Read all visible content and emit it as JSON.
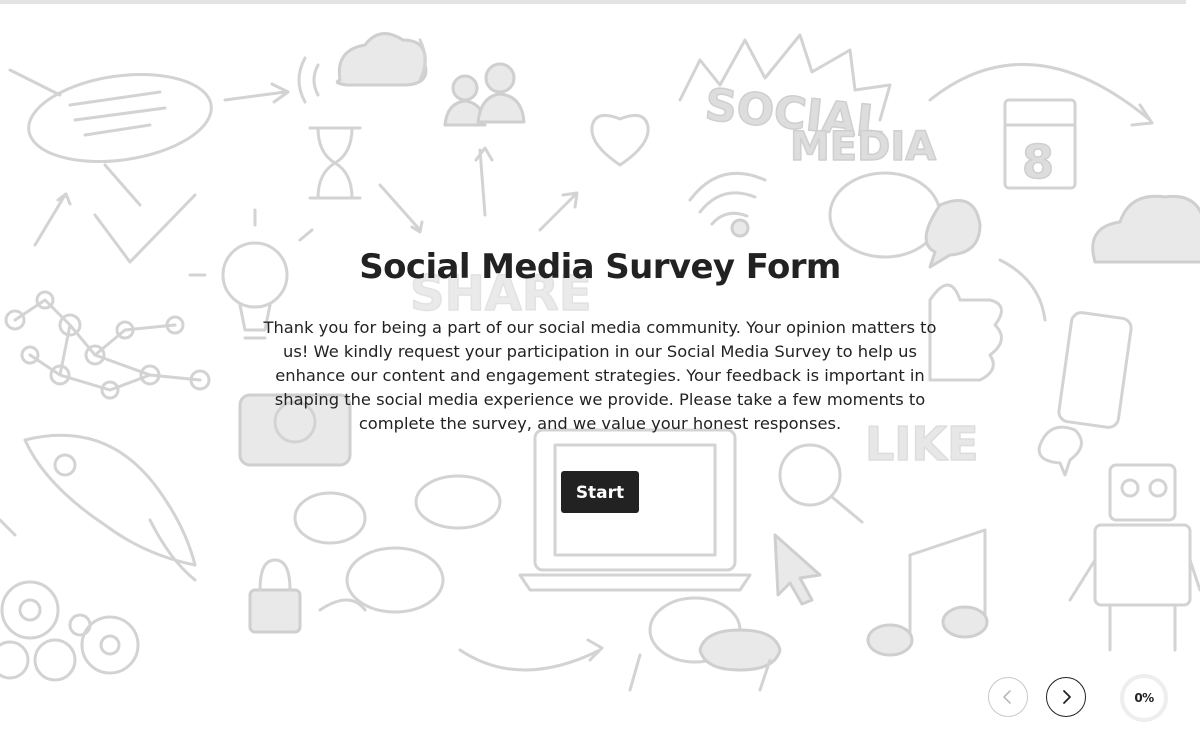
{
  "survey": {
    "title": "Social Media Survey Form",
    "description": "Thank you for being a part of our social media community. Your opinion matters to us! We kindly request your participation in our Social Media Survey to help us enhance our content and engagement strategies. Your feedback is important in shaping the social media experience we provide. Please take a few moments to complete the survey, and we value your honest responses.",
    "start_label": "Start"
  },
  "progress": {
    "text": "0%",
    "value": 0
  },
  "background": {
    "words": [
      "SOCIAL",
      "MEDIA",
      "SHARE",
      "LIKE",
      "8"
    ]
  },
  "navigation": {
    "prev_icon": "chevron-left-icon",
    "next_icon": "chevron-right-icon"
  },
  "colors": {
    "text": "#222222",
    "button_bg": "#222222",
    "button_text": "#ffffff",
    "doodle": "#d3d3d3"
  }
}
